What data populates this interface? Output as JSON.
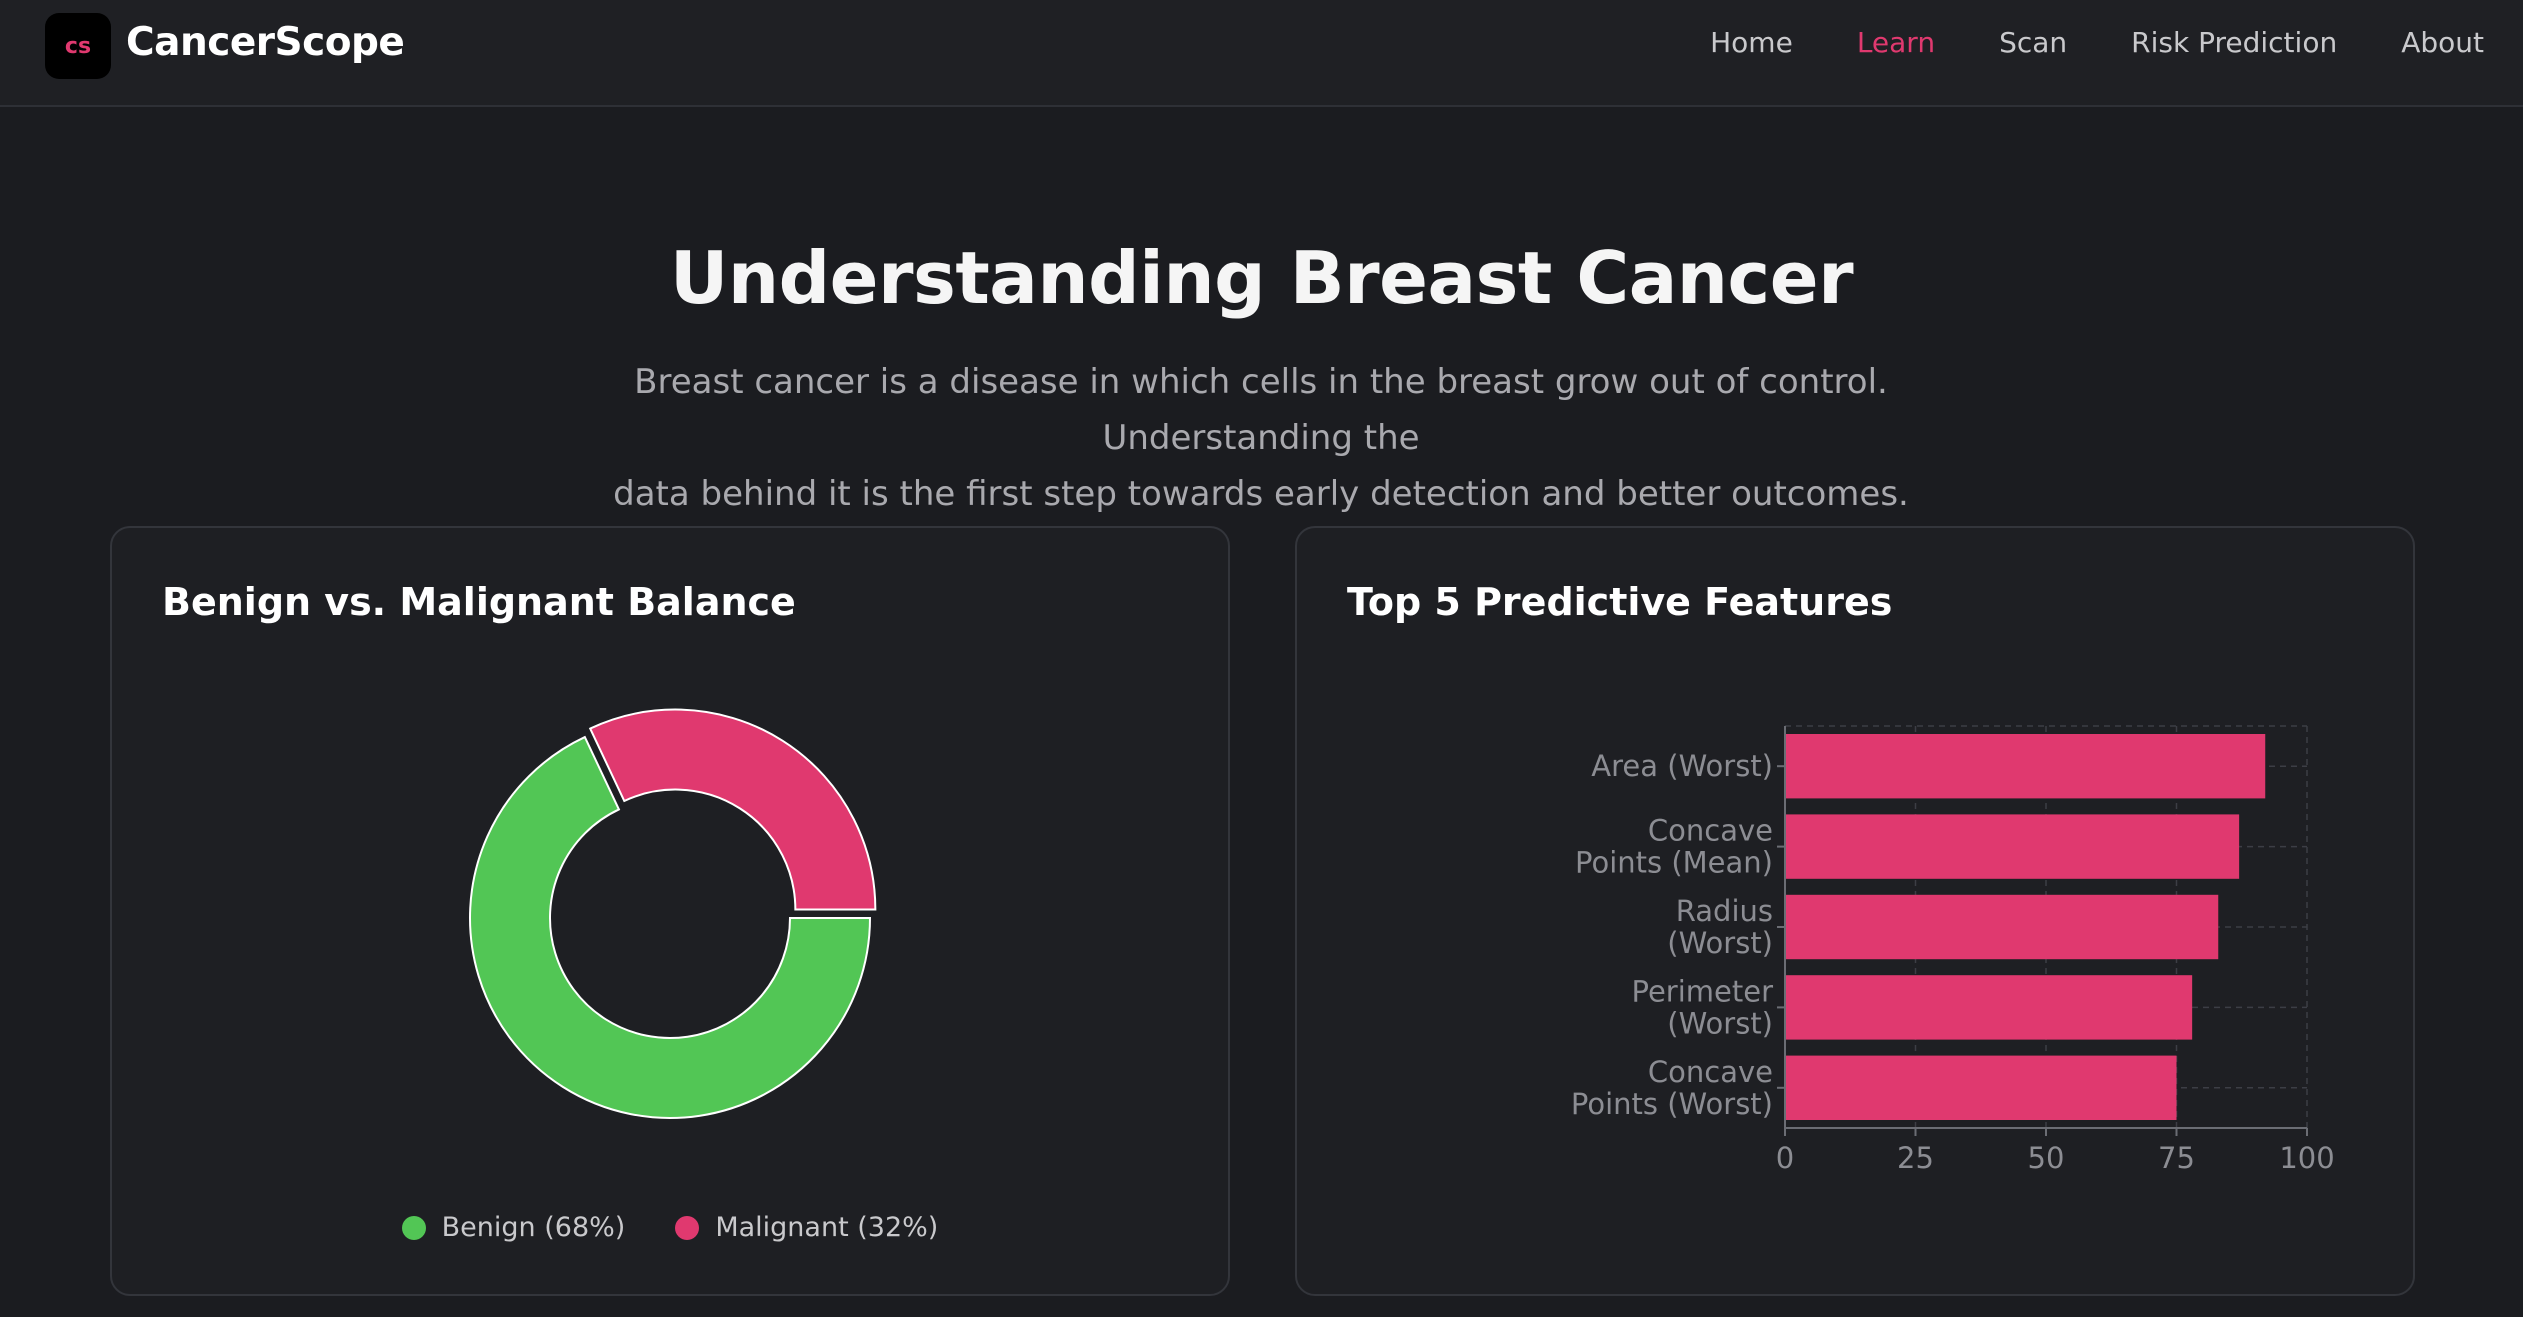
{
  "brand": {
    "logo_text": "cs",
    "name": "CancerScope"
  },
  "nav": {
    "items": [
      {
        "label": "Home",
        "active": false
      },
      {
        "label": "Learn",
        "active": true
      },
      {
        "label": "Scan",
        "active": false
      },
      {
        "label": "Risk Prediction",
        "active": false
      },
      {
        "label": "About",
        "active": false
      }
    ]
  },
  "hero": {
    "title": "Understanding Breast Cancer",
    "subtitle_line1": "Breast cancer is a disease in which cells in the breast grow out of control. Understanding the",
    "subtitle_line2": "data behind it is the first step towards early detection and better outcomes."
  },
  "colors": {
    "accent": "#e0396f",
    "benign": "#52c655",
    "background": "#1b1c20"
  },
  "donut_card": {
    "title": "Benign vs. Malignant Balance",
    "legend": [
      {
        "label": "Benign (68%)",
        "color": "#52c655"
      },
      {
        "label": "Malignant (32%)",
        "color": "#e0396f"
      }
    ]
  },
  "bar_card": {
    "title": "Top 5 Predictive Features"
  },
  "chart_data": [
    {
      "type": "pie",
      "title": "Benign vs. Malignant Balance",
      "categories": [
        "Benign",
        "Malignant"
      ],
      "values": [
        68,
        32
      ],
      "colors": [
        "#52c655",
        "#e0396f"
      ]
    },
    {
      "type": "bar",
      "orientation": "horizontal",
      "title": "Top 5 Predictive Features",
      "categories": [
        [
          "Area (Worst)"
        ],
        [
          "Concave",
          "Points (Mean)"
        ],
        [
          "Radius",
          "(Worst)"
        ],
        [
          "Perimeter",
          "(Worst)"
        ],
        [
          "Concave",
          "Points (Worst)"
        ]
      ],
      "values": [
        92,
        87,
        83,
        78,
        75
      ],
      "xlim": [
        0,
        100
      ],
      "xticks": [
        "0",
        "25",
        "50",
        "75",
        "100"
      ],
      "grid": true,
      "color": "#e0396f"
    }
  ]
}
